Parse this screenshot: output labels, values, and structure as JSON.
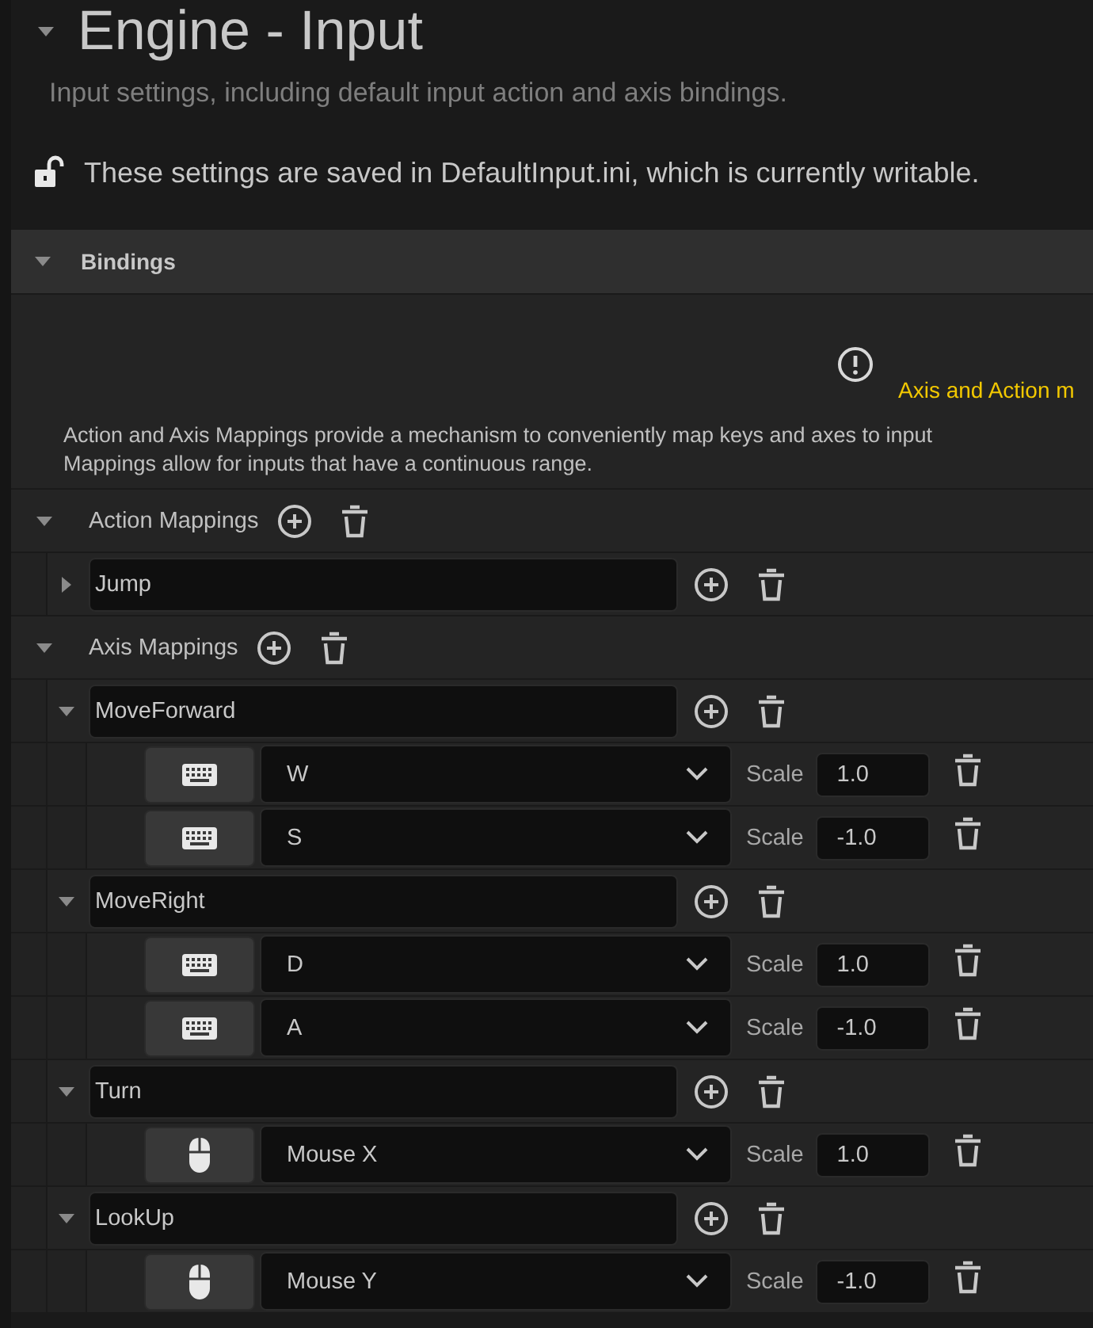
{
  "title": "Engine - Input",
  "expanded": true,
  "description": "Input settings, including default input action and axis bindings.",
  "lock_notice": "These settings are saved in DefaultInput.ini, which is currently writable.",
  "section": {
    "title": "Bindings",
    "expanded": true,
    "warning": "Axis and Action m",
    "info_lines": [
      "Action and Axis Mappings provide a mechanism to conveniently map keys and axes to input",
      "Mappings allow for inputs that have a continuous range."
    ]
  },
  "action_mappings": {
    "label": "Action Mappings",
    "expanded": true,
    "items": [
      {
        "name": "Jump",
        "expanded": false
      }
    ]
  },
  "axis_mappings": {
    "label": "Axis Mappings",
    "expanded": true,
    "items": [
      {
        "name": "MoveForward",
        "expanded": true,
        "keys": [
          {
            "kind": "keyboard",
            "key": "W",
            "scale_label": "Scale",
            "scale": "1.0"
          },
          {
            "kind": "keyboard",
            "key": "S",
            "scale_label": "Scale",
            "scale": "-1.0"
          }
        ]
      },
      {
        "name": "MoveRight",
        "expanded": true,
        "keys": [
          {
            "kind": "keyboard",
            "key": "D",
            "scale_label": "Scale",
            "scale": "1.0"
          },
          {
            "kind": "keyboard",
            "key": "A",
            "scale_label": "Scale",
            "scale": "-1.0"
          }
        ]
      },
      {
        "name": "Turn",
        "expanded": true,
        "keys": [
          {
            "kind": "mouse",
            "key": "Mouse X",
            "scale_label": "Scale",
            "scale": "1.0"
          }
        ]
      },
      {
        "name": "LookUp",
        "expanded": true,
        "keys": [
          {
            "kind": "mouse",
            "key": "Mouse Y",
            "scale_label": "Scale",
            "scale": "-1.0"
          }
        ]
      }
    ]
  }
}
